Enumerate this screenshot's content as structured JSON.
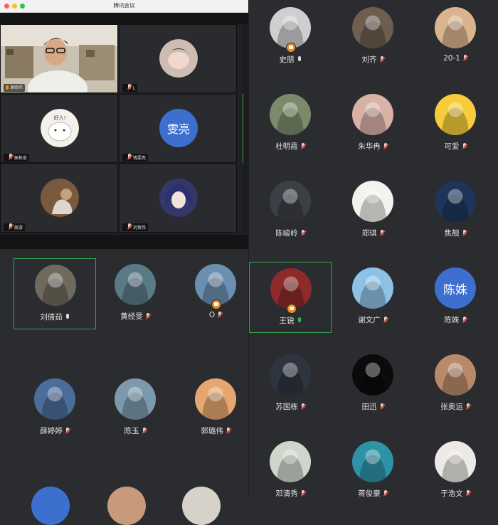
{
  "window": {
    "title": "腾讯会议",
    "traffic_lights": [
      "#ff5f56",
      "#ffbd2e",
      "#27c93f"
    ]
  },
  "video_tiles": [
    {
      "name": "谢晓伟",
      "type": "camera"
    },
    {
      "name": "L",
      "type": "avatar",
      "color": "#c9b8b0"
    },
    {
      "name": "侯栋宏",
      "type": "avatar",
      "color": "#f3efe8",
      "avatar_text": "好人!"
    },
    {
      "name": "钱雯亮",
      "type": "avatar",
      "color": "#3d6fcf",
      "avatar_text": "雯亮"
    },
    {
      "name": "周游",
      "type": "avatar",
      "color": "#7a5a3e"
    },
    {
      "name": "刘贺伟",
      "type": "avatar",
      "color": "#35376a"
    }
  ],
  "participants_left": [
    {
      "name": "刘倩茹",
      "mic": "on",
      "selected": true,
      "color": "#6e6a5c"
    },
    {
      "name": "黄经雯",
      "mic": "off",
      "color": "#5a7a86"
    },
    {
      "name": "O",
      "mic": "off",
      "host": true,
      "color": "#6b8fb0"
    },
    {
      "name": "薛婷婷",
      "mic": "off",
      "color": "#4a6d99"
    },
    {
      "name": "陈玉",
      "mic": "off",
      "color": "#7c99ad"
    },
    {
      "name": "郭璐伟",
      "mic": "off",
      "color": "#e6a66f"
    }
  ],
  "participants_right": [
    {
      "name": "史朋",
      "mic": "on",
      "host": true,
      "color": "#cfcfcf"
    },
    {
      "name": "刘齐",
      "mic": "off",
      "color": "#6d5e4e"
    },
    {
      "name": "20-1",
      "mic": "off",
      "color": "#d9b48e"
    },
    {
      "name": "杜明霞",
      "mic": "off",
      "color": "#7b8a6a"
    },
    {
      "name": "朱华冉",
      "mic": "off",
      "color": "#d8b2a7"
    },
    {
      "name": "可爱",
      "mic": "off",
      "color": "#f6cc3a"
    },
    {
      "name": "陈峻岭",
      "mic": "off",
      "color": "#3c3f45"
    },
    {
      "name": "郑琪",
      "mic": "off",
      "color": "#f4f2ee"
    },
    {
      "name": "焦靓",
      "mic": "off",
      "color": "#1d3558"
    },
    {
      "name": "王锐",
      "mic": "on",
      "mic_color": "green",
      "host": true,
      "selected": true,
      "color": "#8d2a2a"
    },
    {
      "name": "谢文广",
      "mic": "off",
      "color": "#8dc2e6"
    },
    {
      "name": "陈姝",
      "mic": "off",
      "color": "#3d6fcf",
      "avatar_text": "陈姝"
    },
    {
      "name": "苏国栋",
      "mic": "off",
      "color": "#2f3540"
    },
    {
      "name": "田迅",
      "mic": "off",
      "color": "#0b0b0b"
    },
    {
      "name": "张奥运",
      "mic": "off",
      "color": "#b88a6a"
    },
    {
      "name": "邓清秀",
      "mic": "off",
      "color": "#cfd6cc"
    },
    {
      "name": "蒋俊豪",
      "mic": "off",
      "color": "#2f93a8"
    },
    {
      "name": "于浩文",
      "mic": "off",
      "color": "#ece9e6"
    }
  ]
}
